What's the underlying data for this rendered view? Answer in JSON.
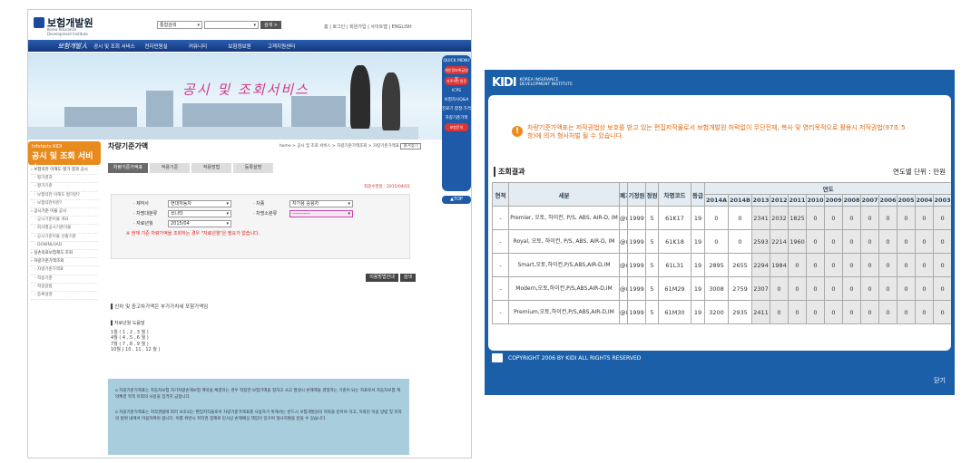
{
  "left": {
    "logo": {
      "name": "보험개발원",
      "sub": "Korea Insurance Development Institute"
    },
    "search": {
      "scope": "통합검색",
      "button": "검색 >"
    },
    "top_links": "홈 | 로그인 | 회원가입 | 사이트맵 | ENGLISH",
    "nav": [
      "보험개발人",
      "공시 및 조회 서비스",
      "전자민원실",
      "커뮤니티",
      "보험정보원",
      "고객지원센터"
    ],
    "banner_title": "공시 및 조회서비스",
    "quick_menu": {
      "title": "QUICK MENU",
      "items": [
        "개인정보취급방침",
        "자주하는질문",
        "ICPS",
        "보험자사Q&A",
        "진료기 합정·가격",
        "차량기준가액",
        "보험문의"
      ],
      "top": "▲TOP"
    },
    "sidebar": {
      "head_small": "Infofacts KIDI",
      "head_big": "공시 및 조회 서비스",
      "items": [
        {
          "label": "› 보험약관 이해도 평가 결과 공시",
          "sub": false
        },
        {
          "label": "- 평가결과",
          "sub": true
        },
        {
          "label": "- 평가기준",
          "sub": true
        },
        {
          "label": "- 보험약관 이해도 평가란?",
          "sub": true
        },
        {
          "label": "- 보험약관이란?",
          "sub": true
        },
        {
          "label": "› 공시기준 이율 공시",
          "sub": false
        },
        {
          "label": "- 공시기준이율 개요",
          "sub": true
        },
        {
          "label": "- 회사별공시기준이율",
          "sub": true
        },
        {
          "label": "- 공시기준이율 산출기준",
          "sub": true
        },
        {
          "label": "- DOWNLOAD",
          "sub": true
        },
        {
          "label": "› 실손의료보험제도 조회",
          "sub": false
        },
        {
          "label": "› 차량기준가액조회",
          "sub": false
        },
        {
          "label": "- 차량기준가액표",
          "sub": true
        },
        {
          "label": "- 적용기준",
          "sub": true
        },
        {
          "label": "- 적용방법",
          "sub": true
        },
        {
          "label": "- 등록설명",
          "sub": true
        }
      ]
    },
    "content": {
      "title": "차량기준가액",
      "breadcrumb": "home > 공시 및 조회 서비스 > 차량기준가액조회 > 차량기준가액표",
      "crumb_btn": "즐겨찾기",
      "tabs": [
        "차량기준가액표",
        "적용기준",
        "적용방법",
        "등록설명"
      ],
      "updated": "최종수정일 : 2015/04/01",
      "form": {
        "maker_label": "· 제작사",
        "maker_value": "현대자동차",
        "model_label": "· 차종",
        "model_value": "자가용 승용차",
        "class_label": "· 차명대분류",
        "class_value": "쏘나타",
        "sub_label": "· 차명소분류",
        "sub_value": "-----------",
        "date_label": "· 자료년월",
        "date_value": "2015/04",
        "warning": "※ 현재 기준 차량가액을 조회하는 경우 \"자료년월\"은 필요가 없습니다."
      },
      "buttons": [
        "이용방법안내",
        "검색"
      ],
      "info1": "▌신차 및 중고차가액은 부가가치세 포함가액임",
      "info2_title": "▌자료년월 도움말",
      "info2_lines": [
        "1월 ( 1 , 2 , 3 월 )",
        "4월 ( 4 , 5 , 6 월 )",
        "7월 ( 7 , 8 , 9 월 )",
        "10월 ( 10 , 11 , 12 월 )"
      ],
      "note1": "o 차량기준가액표는 자동차보험 자기차량손해보험 계약을 체결하는 경우 적정한 보험가액을 정하고 사고 발생시 손해액을 결정하는 기준이 되는 자료로서 자동차보험 계약체결 목적 이외의 사용을 엄격히 금합니다.",
      "note2": "o 차량기준가액표는 저작권법에 따라 보호되는 편집저작물로서 차량기준가액표를 사용하기 위해서는 반드시 보험개발원의 허락을 받아야 하고, 허락된 이용 방법 및 목적의 범위 내에서 이용하여야 합니다. 이를 위반시 저작권 침해로 민사상 손해배상 책임이 있으며 형사처벌을 받을 수 있습니다."
    }
  },
  "right": {
    "logo": "KIDI",
    "logo_sub1": "KOREA INSURANCE",
    "logo_sub2": "DEVELOPMENT INSTITUTE",
    "warning": "차량기준가액표는 저작권법상 보호를 받고 있는 편집저작물로서 보험개발원 허락없이 무단전재, 복사 및 영리목적으로 활용시 저작권법(97조 5항)에 의거 형사처벌 될 수 있습니다.",
    "section_title": "조회결과",
    "unit": "연도별 단위 : 만원",
    "headers": {
      "exists": "현적",
      "segment": "세분",
      "discontinued": "폐기",
      "seating": "기정원",
      "displacement": "정원",
      "code": "차명코드",
      "grade": "등급",
      "year_group": "연도",
      "years": [
        "2014A",
        "2014B",
        "2013",
        "2012",
        "2011",
        "2010",
        "2009",
        "2008",
        "2007",
        "2006",
        "2005",
        "2004",
        "2003"
      ]
    },
    "rows": [
      {
        "exists": "-",
        "segment": "Premier, 오토, 하이컨, P/S, ABS, AIR-D, IM",
        "mark": "@&",
        "disp": "1999",
        "seat": "5",
        "code": "61K17",
        "grade": "19",
        "values": [
          "0",
          "0",
          "2341",
          "2032",
          "1825",
          "0",
          "0",
          "0",
          "0",
          "0",
          "0",
          "0",
          "0"
        ]
      },
      {
        "exists": "-",
        "segment": "Royal, 오토, 하이컨, P/S, ABS, AIR-D, IM",
        "mark": "@&",
        "disp": "1999",
        "seat": "5",
        "code": "61K18",
        "grade": "19",
        "values": [
          "0",
          "0",
          "2593",
          "2214",
          "1960",
          "0",
          "0",
          "0",
          "0",
          "0",
          "0",
          "0",
          "0"
        ]
      },
      {
        "exists": "-",
        "segment": "Smart,오토,하이컨,P/S,ABS,AIR-D,IM",
        "mark": "@&",
        "disp": "1999",
        "seat": "5",
        "code": "61L31",
        "grade": "19",
        "values": [
          "2895",
          "2655",
          "2294",
          "1984",
          "0",
          "0",
          "0",
          "0",
          "0",
          "0",
          "0",
          "0",
          "0"
        ]
      },
      {
        "exists": "-",
        "segment": "Modern,오토,하이컨,P/S,ABS,AIR-D,IM",
        "mark": "@&",
        "disp": "1999",
        "seat": "5",
        "code": "61M29",
        "grade": "19",
        "values": [
          "3008",
          "2759",
          "2307",
          "0",
          "0",
          "0",
          "0",
          "0",
          "0",
          "0",
          "0",
          "0",
          "0"
        ]
      },
      {
        "exists": "-",
        "segment": "Premium,오토,하이컨,P/S,ABS,AIR-D,IM",
        "mark": "@&",
        "disp": "1999",
        "seat": "5",
        "code": "61M30",
        "grade": "19",
        "values": [
          "3200",
          "2935",
          "2411",
          "0",
          "0",
          "0",
          "0",
          "0",
          "0",
          "0",
          "0",
          "0",
          "0"
        ]
      }
    ],
    "copyright": "COPYRIGHT 2006 BY KIDI ALL RIGHTS RESERVED",
    "close": "닫기"
  }
}
